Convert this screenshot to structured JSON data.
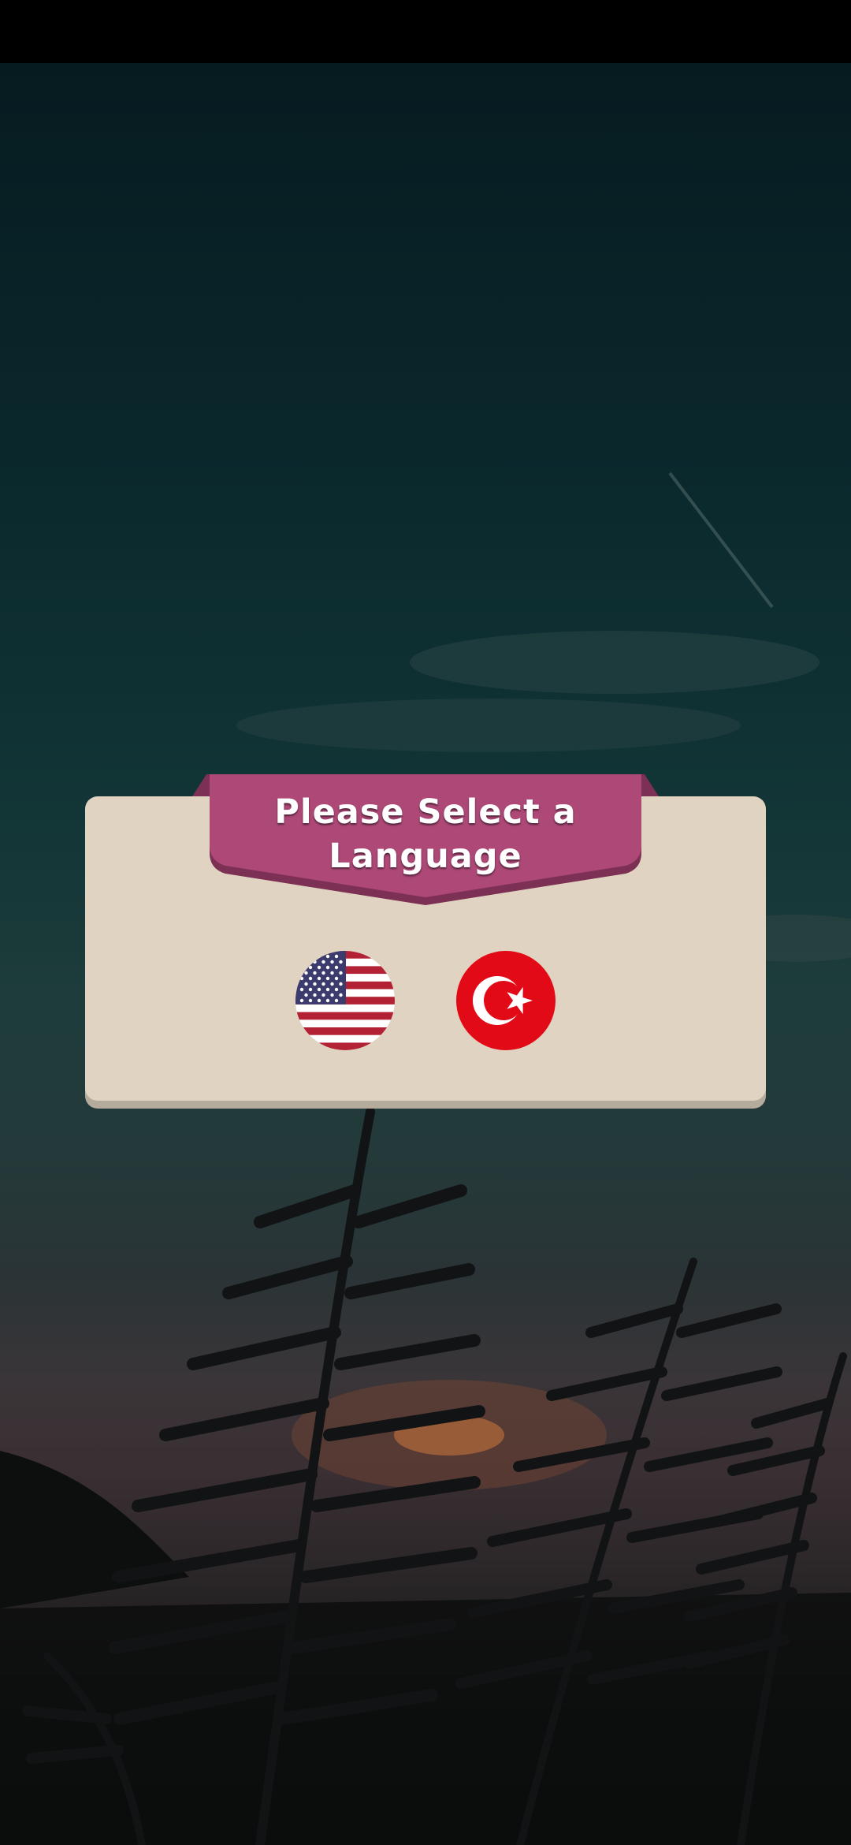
{
  "dialog": {
    "title": "Please Select a Language",
    "title_line1": "Please Select a",
    "title_line2": "Language"
  },
  "languages": [
    {
      "code": "en",
      "icon": "us-flag-icon"
    },
    {
      "code": "tr",
      "icon": "turkey-flag-icon"
    }
  ],
  "colors": {
    "ribbon": "#ad4877",
    "ribbon_dark": "#7c3054",
    "dialog_bg": "#e0d3c1",
    "dialog_shadow": "#b4ab9d",
    "turkey_red": "#e30a17",
    "us_red": "#b22234",
    "us_blue": "#3c3b6e"
  }
}
